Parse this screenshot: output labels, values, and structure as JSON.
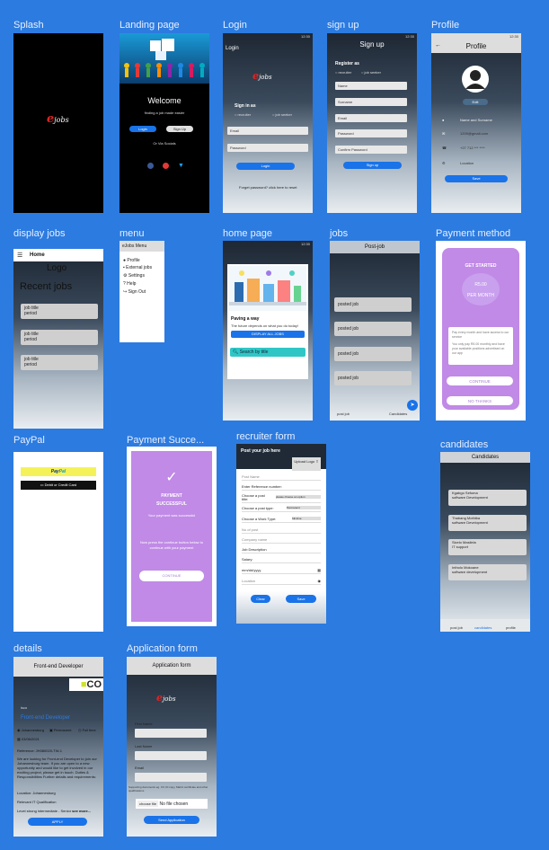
{
  "labels": {
    "splash": "Splash",
    "landing": "Landing page",
    "login": "Login",
    "signup": "sign up",
    "profile": "Profile",
    "display_jobs": "display jobs",
    "menu": "menu",
    "home": "home page",
    "jobs": "jobs",
    "payment_method": "Payment method",
    "paypal": "PayPal",
    "payment_success": "Payment Succe...",
    "recruiter_form": "recruiter form",
    "candidates": "candidates",
    "details": "details",
    "application_form": "Application form"
  },
  "brand": {
    "e": "e",
    "jobs": "jobs"
  },
  "colors": {
    "accent": "#1a73e8",
    "background": "#2c7be0",
    "purple": "#c08ae6",
    "danger": "#e02424"
  },
  "landing": {
    "welcome": "Welcome",
    "tagline": "finding a job made easier",
    "login": "Login",
    "signup": "Sign Up",
    "or_via": "Or Via Socials"
  },
  "login": {
    "title": "Login",
    "time": "12:30",
    "sign_in_as": "Sign in as",
    "role_recruiter": "recruiter",
    "role_seeker": "job seeker",
    "email": "Email",
    "password": "Password",
    "button": "Login",
    "forgot": "Forget password?",
    "reset": "click here to reset"
  },
  "signup": {
    "title": "Sign up",
    "time": "12:30",
    "register_as": "Register as",
    "role_recruiter": "recruiter",
    "role_seeker": "job seeker",
    "fields": [
      "Name",
      "Surname",
      "Email",
      "Password",
      "Confirm Password"
    ],
    "button": "Sign up"
  },
  "profile": {
    "title": "Profile",
    "time": "12:30",
    "edit": "Edit",
    "rows": [
      "Name and Surname",
      "1209@gmail.com",
      "+27 712 *** ****",
      "Location"
    ],
    "button": "Save"
  },
  "display_jobs": {
    "home": "Home",
    "logo": "Logo",
    "recent": "Recent jobs",
    "items": [
      "job title\nperiod",
      "job title\nperiod",
      "job title\nperiod"
    ]
  },
  "menu": {
    "header": "eJobs Menu",
    "items": [
      "Profile",
      "External jobs",
      "Settings",
      "Help",
      "Sign Out"
    ]
  },
  "home": {
    "time": "12:30",
    "heading": "Paving a way",
    "sub": "The future depends on what you do today!",
    "display_all": "DISPLAY ALL JOBS",
    "search": "Search by title"
  },
  "jobs": {
    "header": "Post-job",
    "items": [
      "posted job",
      "posted job",
      "posted job",
      "posted job"
    ],
    "nav_post": "post job",
    "nav_candidates": "Candidates"
  },
  "payment": {
    "title": "GET STARTED",
    "price": "R5.00",
    "per": "PER MONTH",
    "desc1": "Pay every month and have access to our service",
    "desc2": "You only pay R5.00 monthly and have your available positions advertised on our app",
    "continue": "CONTINUE",
    "no_thanks": "NO THANKS"
  },
  "paypal": {
    "pay_pre": "Pay",
    "pay_post": "Pal",
    "debit": "Debit or Credit Card"
  },
  "success": {
    "title": "PAYMENT",
    "title2": "SUCCESSFUL",
    "sub": "Your payment was successful",
    "desc": "Now press the continue button below to continue with your payment",
    "button": "CONTINUE"
  },
  "recruiter": {
    "header": "Post your job here",
    "upload": "Upload Logo",
    "post_name": "Post Name",
    "reference": "Enter Reference number:",
    "choose_title": "Choose a post title:",
    "choose_title_value": "please choose an option",
    "choose_type": "Choose a post type:",
    "choose_type_value": "Permanent",
    "choose_work": "Choose a Work Type:",
    "choose_work_value": "full-time",
    "no_post": "No of post",
    "company": "Company name",
    "description": "Job Description",
    "salary": "Salary:",
    "date": "mm/dd/yyyy",
    "location": "Location",
    "clear": "Clear",
    "save": "Save"
  },
  "candidates": {
    "header": "Candidates",
    "items": [
      "Kgabgo Sefoma\n          software Development",
      "Thabang Mothiba\n          software Development",
      "Sicelo Masilela\n          IT support",
      "Intholo Mokoane\n          software development"
    ],
    "nav": [
      "post job",
      "candidates",
      "profile"
    ]
  },
  "details": {
    "header": "Front-end Developer",
    "logo": "CO",
    "company": "isco",
    "role": "Front-end Developer",
    "location": "Johannesburg",
    "type": "Permanent",
    "hours": "Full time",
    "date": "03/06/2021",
    "reference": "Reference: JH080020-TW-1",
    "body": "We are looking for Front-end Developer to join our Johannesburg team. If you are open to a new opportunity and would like to get involved in our exciting project, please get in touch. Duties & Responsibilities Further details and requirements:",
    "loc_line": "Location: Johannesburg",
    "qual": "Relevant IT Qualification",
    "level": "Level strong intermediate - Senior",
    "see_more": "see more...",
    "apply": "APPLY"
  },
  "appform": {
    "header": "Application form",
    "first": "First Name",
    "last": "Last Name",
    "email": "Email",
    "note": "Supporting documents eg. CV, ID copy, Matric certificate and other qualifications",
    "choose": "choose file",
    "no_file": "No file chosen",
    "submit": "Send Application"
  }
}
